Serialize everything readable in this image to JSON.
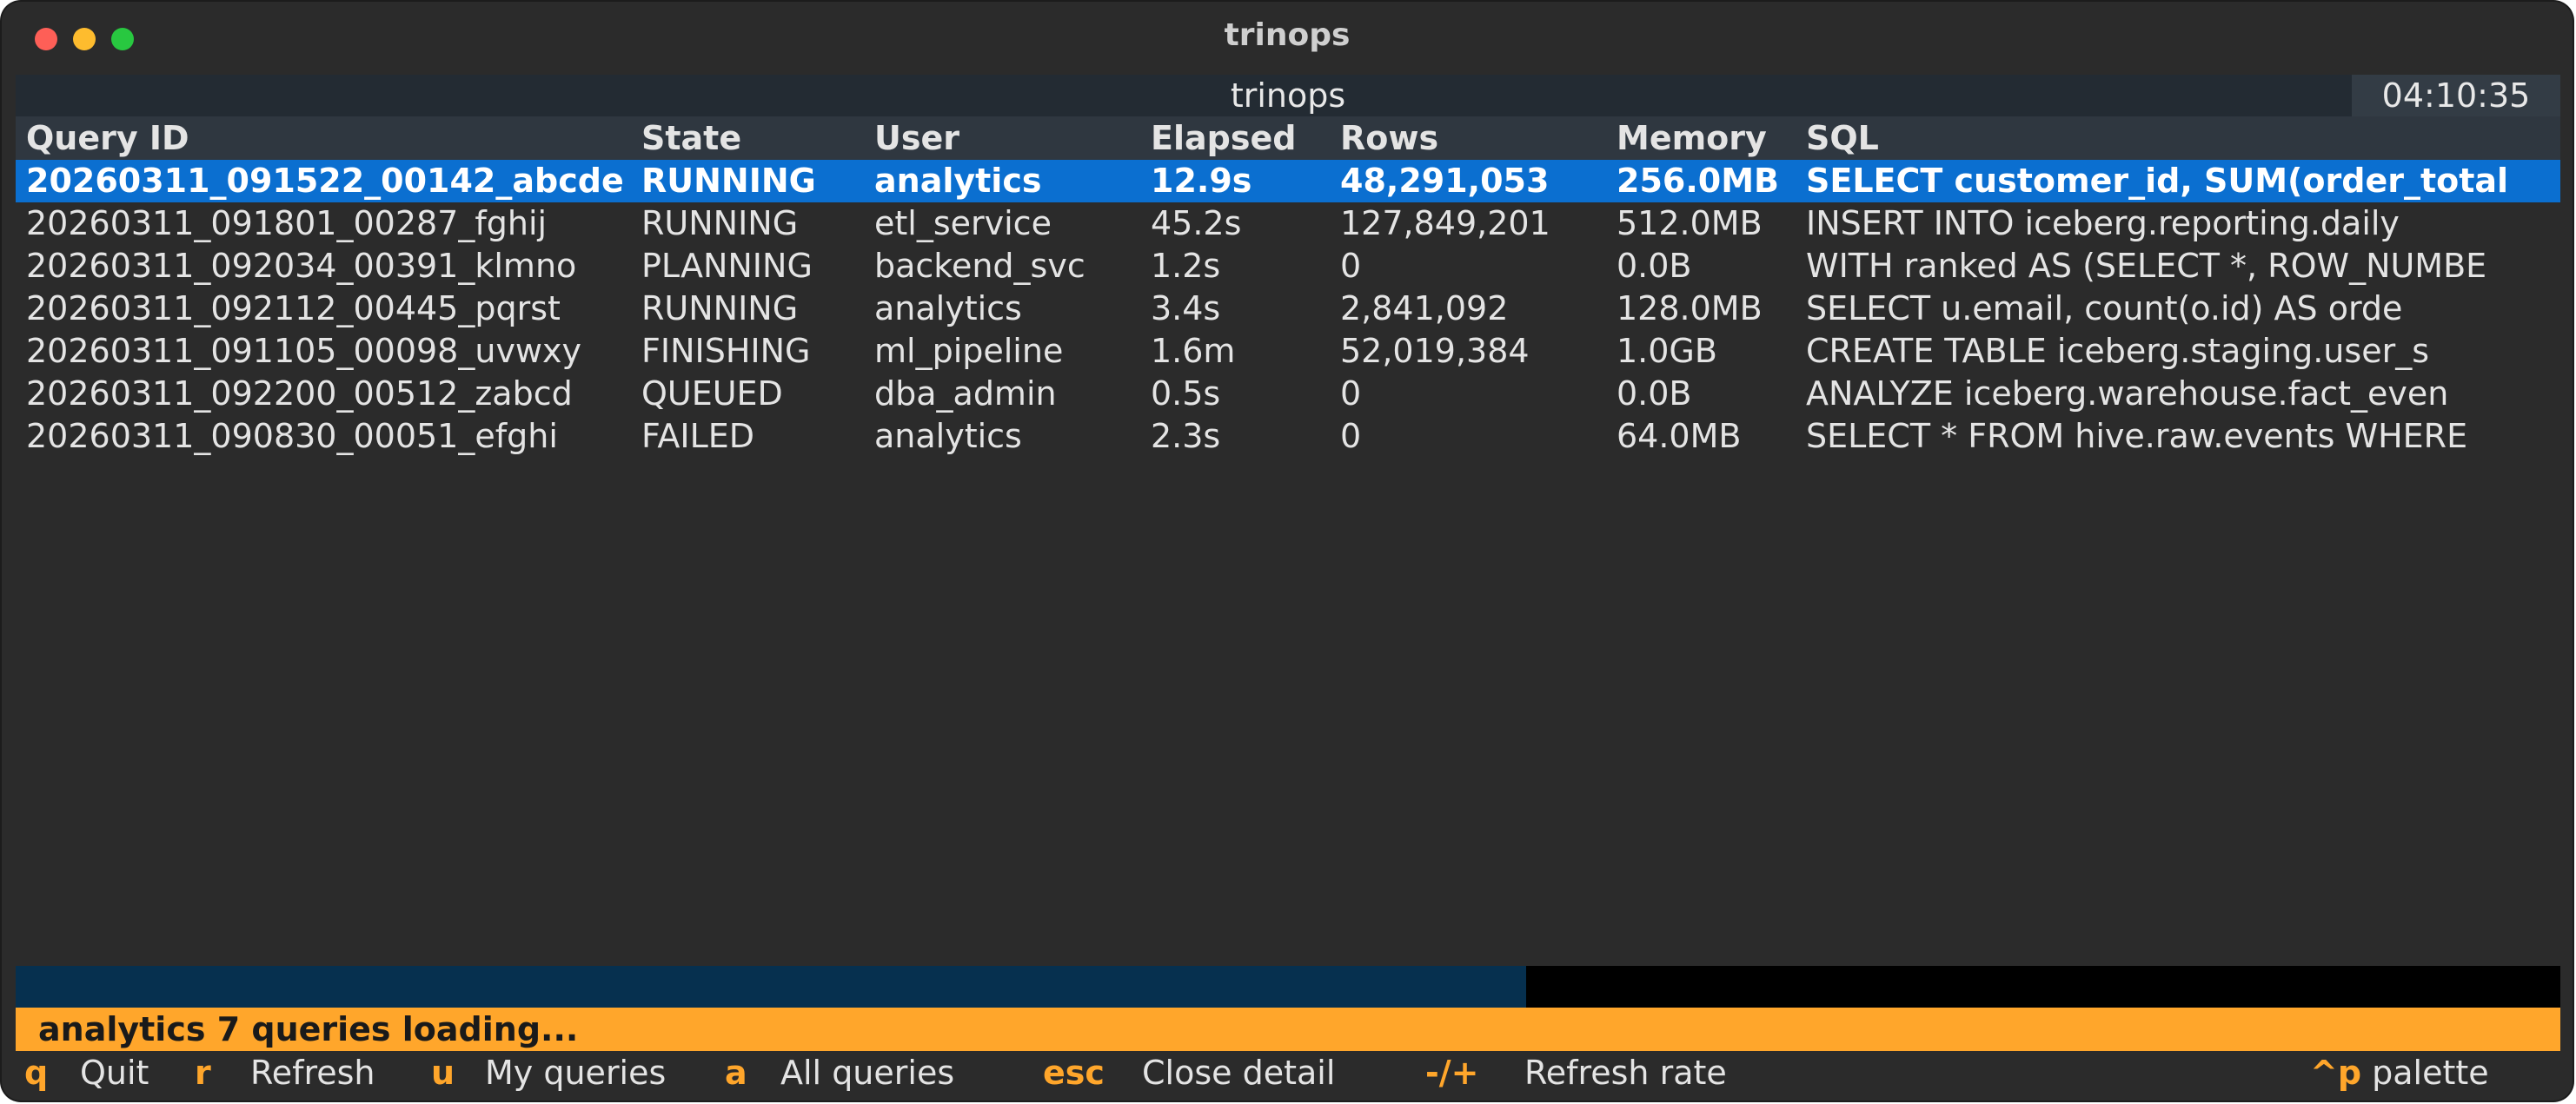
{
  "window": {
    "title": "trinops"
  },
  "header": {
    "icon": "",
    "title": "trinops",
    "clock": "04:10:35"
  },
  "table": {
    "columns": [
      "Query ID",
      "State",
      "User",
      "Elapsed",
      "Rows",
      "Memory",
      "SQL"
    ],
    "rows": [
      [
        "20260311_091522_00142_abcde",
        "RUNNING",
        "analytics",
        "12.9s",
        "48,291,053",
        "256.0MB",
        "SELECT customer_id, SUM(order_total"
      ],
      [
        "20260311_091801_00287_fghij",
        "RUNNING",
        "etl_service",
        "45.2s",
        "127,849,201",
        "512.0MB",
        "INSERT INTO iceberg.reporting.daily"
      ],
      [
        "20260311_092034_00391_klmno",
        "PLANNING",
        "backend_svc",
        "1.2s",
        "0",
        "0.0B",
        "WITH ranked AS (SELECT *, ROW_NUMBE"
      ],
      [
        "20260311_092112_00445_pqrst",
        "RUNNING",
        "analytics",
        "3.4s",
        "2,841,092",
        "128.0MB",
        "SELECT u.email, count(o.id) AS orde"
      ],
      [
        "20260311_091105_00098_uvwxy",
        "FINISHING",
        "ml_pipeline",
        "1.6m",
        "52,019,384",
        "1.0GB",
        "CREATE TABLE iceberg.staging.user_s"
      ],
      [
        "20260311_092200_00512_zabcd",
        "QUEUED",
        "dba_admin",
        "0.5s",
        "0",
        "0.0B",
        "ANALYZE iceberg.warehouse.fact_even"
      ],
      [
        "20260311_090830_00051_efghi",
        "FAILED",
        "analytics",
        "2.3s",
        "0",
        "64.0MB",
        "SELECT * FROM hive.raw.events WHERE"
      ]
    ],
    "selected_index": 0
  },
  "progress": {
    "fraction": 0.6,
    "cursor": ""
  },
  "status": {
    "text": "analytics  7 queries  loading..."
  },
  "footer": {
    "items": [
      {
        "key": "q",
        "label": "Quit"
      },
      {
        "key": "r",
        "label": "Refresh"
      },
      {
        "key": "u",
        "label": "My queries"
      },
      {
        "key": "a",
        "label": "All queries"
      },
      {
        "key": "esc",
        "label": "Close detail"
      },
      {
        "key": "-/+",
        "label": "Refresh rate"
      }
    ],
    "palette": {
      "prefix": "",
      "key": "^p",
      "label": "palette"
    }
  }
}
